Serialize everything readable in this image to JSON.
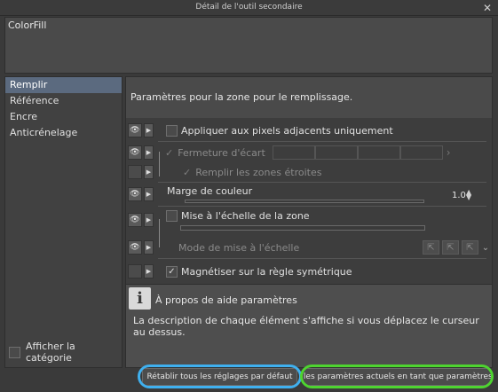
{
  "window": {
    "title": "Détail de l'outil secondaire",
    "close_glyph": "✕"
  },
  "tool_name": "ColorFill",
  "sidebar": {
    "items": [
      {
        "label": "Remplir"
      },
      {
        "label": "Référence"
      },
      {
        "label": "Encre"
      },
      {
        "label": "Anticrénelage"
      }
    ],
    "selected": "Remplir",
    "show_category_label": "Afficher la catégorie",
    "show_category_checked": false
  },
  "panel": {
    "description": "Paramètres pour la zone pour le remplissage.",
    "rows": {
      "adjacent": {
        "label": "Appliquer aux pixels adjacents uniquement",
        "checked": false
      },
      "gap_closing": {
        "label": "Fermeture d'écart",
        "checked": true,
        "enabled": false
      },
      "fill_narrow": {
        "label": "Remplir les zones étroites",
        "checked": true,
        "enabled": false
      },
      "color_margin": {
        "label": "Marge de couleur",
        "value": "1.0"
      },
      "scale_area": {
        "label": "Mise à l'échelle de la zone",
        "checked": false
      },
      "scale_mode": {
        "label": "Mode de mise à l'échelle",
        "enabled": false
      },
      "snap_symmetry": {
        "label": "Magnétiser sur la règle symétrique",
        "checked": true
      }
    }
  },
  "help": {
    "title": "À propos de aide paramètres",
    "text": "La description de chaque élément s'affiche si vous déplacez le curseur au dessus."
  },
  "buttons": {
    "reset": "Rétablir tous les réglages par défaut",
    "save": "Enregistrer les paramètres actuels en tant que paramètres par défaut"
  },
  "highlight_colors": {
    "reset_outline": "#3fb0ef",
    "save_outline": "#4ed430"
  }
}
